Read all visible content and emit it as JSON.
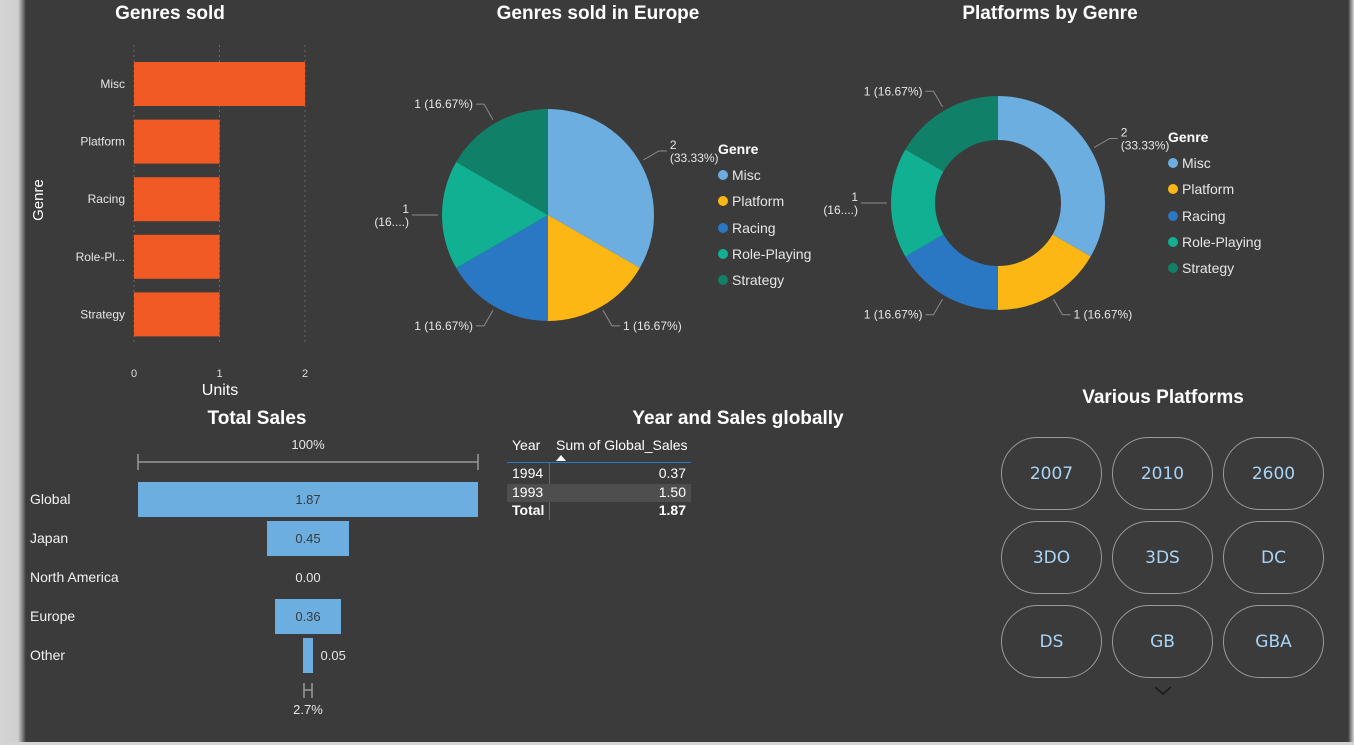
{
  "genres_sold": {
    "title": "Genres sold",
    "y_axis_title": "Genre",
    "x_axis_title": "Units",
    "bar_color": "#f15a24",
    "chart_data": {
      "type": "bar",
      "orientation": "horizontal",
      "categories": [
        "Misc",
        "Platform",
        "Racing",
        "Role-Pl...",
        "Strategy"
      ],
      "values": [
        2,
        1,
        1,
        1,
        1
      ],
      "xticks": [
        "0",
        "1",
        "2"
      ],
      "xlim": [
        0,
        2
      ],
      "xlabel": "Units",
      "ylabel": "Genre"
    }
  },
  "genres_europe": {
    "title": "Genres sold in Europe",
    "legend_title": "Genre",
    "labels": [
      "2\n(33.33%)",
      "1 (16.67%)",
      "1 (16.67%)",
      "1\n(16....)",
      "1 (16.67%)"
    ],
    "chart_data": {
      "type": "pie",
      "categories": [
        "Misc",
        "Platform",
        "Racing",
        "Role-Playing",
        "Strategy"
      ],
      "values": [
        2,
        1,
        1,
        1,
        1
      ],
      "colors": [
        "#6caee0",
        "#fdb714",
        "#2a78c4",
        "#11b092",
        "#118068"
      ]
    }
  },
  "platforms_by_genre": {
    "title": "Platforms by Genre",
    "legend_title": "Genre",
    "labels": [
      "2\n(33.33%)",
      "1 (16.67%)",
      "1 (16.67%)",
      "1\n(16....)",
      "1 (16.67%)"
    ],
    "chart_data": {
      "type": "donut",
      "categories": [
        "Misc",
        "Platform",
        "Racing",
        "Role-Playing",
        "Strategy"
      ],
      "values": [
        2,
        1,
        1,
        1,
        1
      ],
      "colors": [
        "#6caee0",
        "#fdb714",
        "#2a78c4",
        "#11b092",
        "#118068"
      ]
    }
  },
  "total_sales": {
    "title": "Total Sales",
    "top_percent": "100%",
    "bottom_percent": "2.7%",
    "bar_color": "#6caee0",
    "chart_data": {
      "type": "funnel",
      "categories": [
        "Global",
        "Japan",
        "North America",
        "Europe",
        "Other"
      ],
      "values": [
        1.87,
        0.45,
        0.0,
        0.36,
        0.05
      ],
      "value_labels": [
        "1.87",
        "0.45",
        "0.00",
        "0.36",
        "0.05"
      ]
    }
  },
  "year_sales": {
    "title": "Year and Sales globally",
    "columns": [
      "Year",
      "Sum of Global_Sales"
    ],
    "rows": [
      {
        "year": "1994",
        "value": "0.37"
      },
      {
        "year": "1993",
        "value": "1.50"
      }
    ],
    "total": {
      "label": "Total",
      "value": "1.87"
    }
  },
  "various_platforms": {
    "title": "Various Platforms",
    "buttons": [
      "2007",
      "2010",
      "2600",
      "3DO",
      "3DS",
      "DC",
      "DS",
      "GB",
      "GBA"
    ]
  }
}
